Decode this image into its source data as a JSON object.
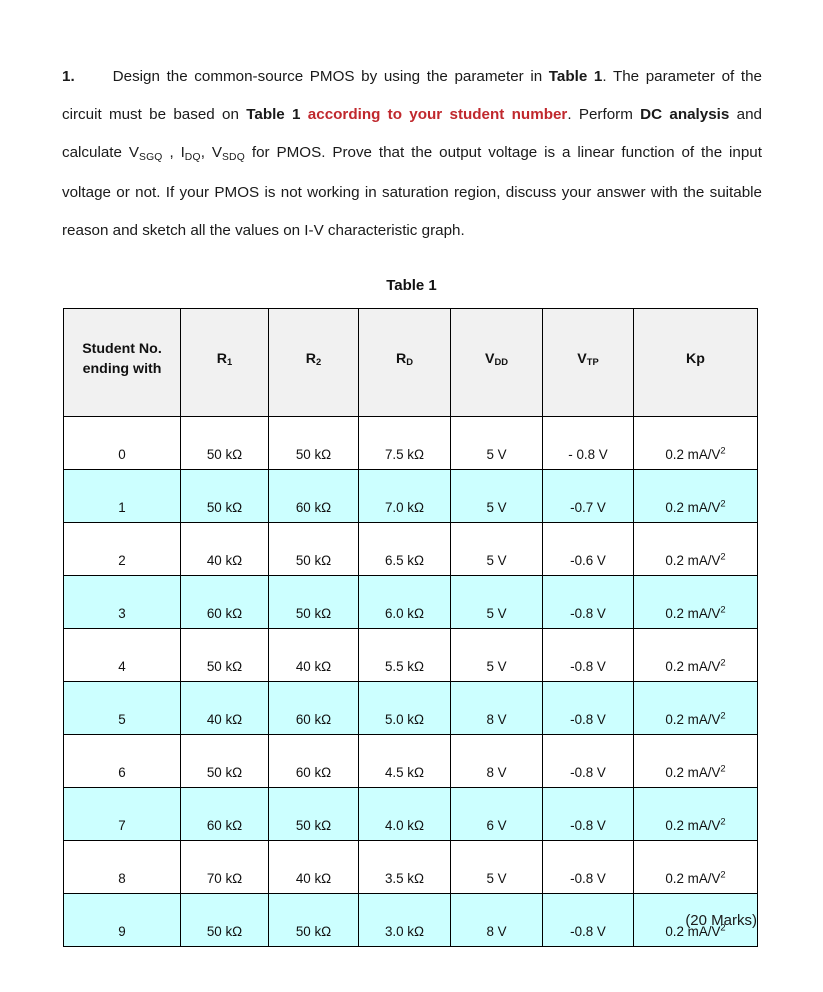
{
  "document": {
    "question_number": "1.",
    "paragraph_parts": [
      {
        "text": "Design the common-source PMOS by using the parameter in ",
        "style": "normal"
      },
      {
        "text": "Table 1",
        "style": "bold"
      },
      {
        "text": ". The parameter of the circuit must be based on ",
        "style": "normal"
      },
      {
        "text": "Table 1 ",
        "style": "bold"
      },
      {
        "text": "according to your student number",
        "style": "red-bold"
      },
      {
        "text": ". Perform ",
        "style": "normal"
      },
      {
        "text": "DC analysis",
        "style": "bold"
      },
      {
        "text": " and calculate ",
        "style": "normal"
      },
      {
        "text": "VSGQ , IDQ, VSDQ",
        "style": "subscripted"
      },
      {
        "text": " for PMOS. Prove that the output voltage is a linear function of the input voltage or not. If your PMOS is not working in saturation region, discuss your answer with the suitable reason and sketch all the values on I-V characteristic graph.",
        "style": "normal"
      }
    ],
    "segments": {
      "s1": "Design  the  common-source  PMOS  by  using  the  parameter  in ",
      "s2": "Table 1",
      "s3": ". The parameter of the circuit must be based on ",
      "s4": "Table 1",
      "s5": " ",
      "s6": "according to your student number",
      "s7": ". Perform ",
      "s8": "DC analysis",
      "s9": " and calculate ",
      "v1_base": "V",
      "v1_sub": "SGQ",
      "sep1": " , ",
      "v2_base": "I",
      "v2_sub": "DQ",
      "sep2": ", ",
      "v3_base": "V",
      "v3_sub": "SDQ",
      "s10": " for PMOS. Prove that the output voltage is a linear function of the input voltage or not. If your PMOS is not working in saturation region, discuss your answer with the suitable reason and sketch all the values on I-V characteristic graph."
    },
    "table_caption": "Table 1",
    "marks": "(20 Marks)"
  },
  "colors": {
    "red_accent": "#C0282D",
    "row_highlight": "#CCFFFF",
    "header_bg": "#F1F1F1",
    "border": "#000000",
    "text": "#1A1A1A"
  },
  "table": {
    "headers": [
      {
        "line1": "Student No.",
        "line2": "ending with",
        "base": "",
        "sub": ""
      },
      {
        "line1": "",
        "line2": "",
        "base": "R",
        "sub": "1"
      },
      {
        "line1": "",
        "line2": "",
        "base": "R",
        "sub": "2"
      },
      {
        "line1": "",
        "line2": "",
        "base": "R",
        "sub": "D"
      },
      {
        "line1": "",
        "line2": "",
        "base": "V",
        "sub": "DD"
      },
      {
        "line1": "",
        "line2": "",
        "base": "V",
        "sub": "TP"
      },
      {
        "line1": "",
        "line2": "",
        "base": "Kp",
        "sub": ""
      }
    ],
    "kp_value": "0.2 mA/V",
    "kp_exponent": "2",
    "rows": [
      {
        "student": "0",
        "r1": "50 kΩ",
        "r2": "50 kΩ",
        "rd": "7.5 kΩ",
        "vdd": "5 V",
        "vtp": "- 0.8 V",
        "kp": "0.2 mA/V",
        "kp_sup": "2",
        "highlight": false
      },
      {
        "student": "1",
        "r1": "50 kΩ",
        "r2": "60 kΩ",
        "rd": "7.0 kΩ",
        "vdd": "5 V",
        "vtp": "-0.7 V",
        "kp": "0.2 mA/V",
        "kp_sup": "2",
        "highlight": true
      },
      {
        "student": "2",
        "r1": "40 kΩ",
        "r2": "50 kΩ",
        "rd": "6.5 kΩ",
        "vdd": "5 V",
        "vtp": "-0.6 V",
        "kp": "0.2 mA/V",
        "kp_sup": "2",
        "highlight": false
      },
      {
        "student": "3",
        "r1": "60 kΩ",
        "r2": "50 kΩ",
        "rd": "6.0 kΩ",
        "vdd": "5 V",
        "vtp": "-0.8 V",
        "kp": "0.2 mA/V",
        "kp_sup": "2",
        "highlight": true
      },
      {
        "student": "4",
        "r1": "50 kΩ",
        "r2": "40 kΩ",
        "rd": "5.5 kΩ",
        "vdd": "5 V",
        "vtp": "-0.8 V",
        "kp": "0.2 mA/V",
        "kp_sup": "2",
        "highlight": false
      },
      {
        "student": "5",
        "r1": "40 kΩ",
        "r2": "60 kΩ",
        "rd": "5.0 kΩ",
        "vdd": "8 V",
        "vtp": "-0.8 V",
        "kp": "0.2 mA/V",
        "kp_sup": "2",
        "highlight": true
      },
      {
        "student": "6",
        "r1": "50 kΩ",
        "r2": "60 kΩ",
        "rd": "4.5 kΩ",
        "vdd": "8 V",
        "vtp": "-0.8 V",
        "kp": "0.2 mA/V",
        "kp_sup": "2",
        "highlight": false
      },
      {
        "student": "7",
        "r1": "60 kΩ",
        "r2": "50 kΩ",
        "rd": "4.0 kΩ",
        "vdd": "6 V",
        "vtp": "-0.8 V",
        "kp": "0.2 mA/V",
        "kp_sup": "2",
        "highlight": true
      },
      {
        "student": "8",
        "r1": "70 kΩ",
        "r2": "40 kΩ",
        "rd": "3.5 kΩ",
        "vdd": "5 V",
        "vtp": "-0.8 V",
        "kp": "0.2 mA/V",
        "kp_sup": "2",
        "highlight": false
      },
      {
        "student": "9",
        "r1": "50 kΩ",
        "r2": "50 kΩ",
        "rd": "3.0 kΩ",
        "vdd": "8 V",
        "vtp": "-0.8 V",
        "kp": "0.2 mA/V",
        "kp_sup": "2",
        "highlight": true
      }
    ]
  }
}
